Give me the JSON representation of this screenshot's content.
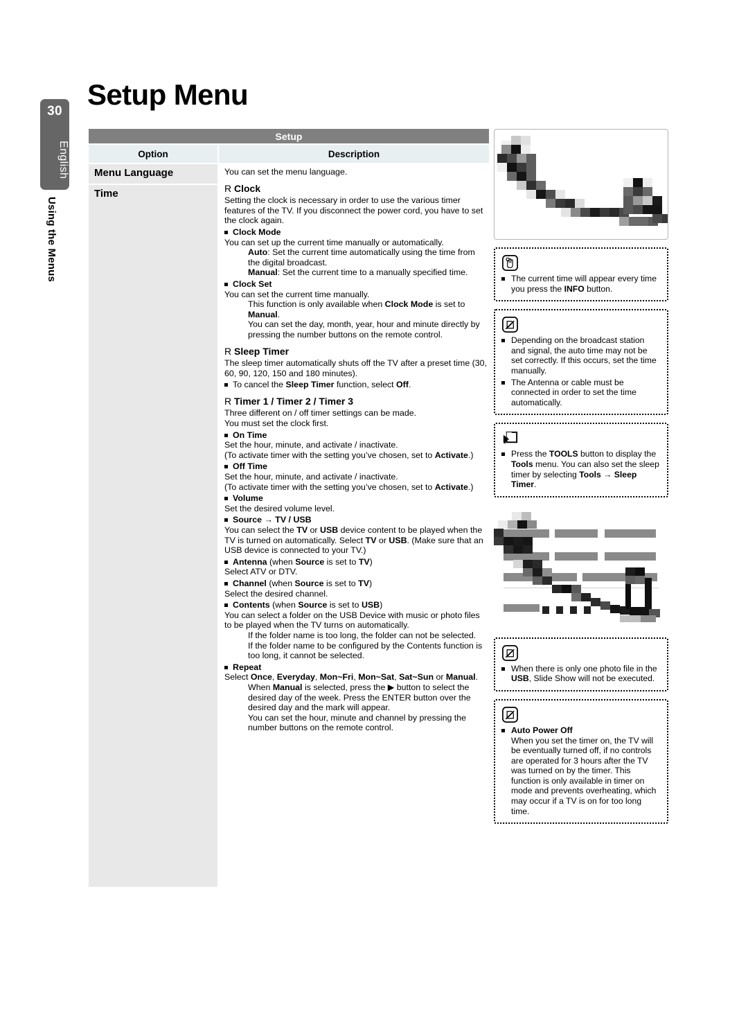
{
  "sidebar": {
    "page_number": "30",
    "language": "English",
    "chapter": "Using the Menus"
  },
  "page_title": "Setup Menu",
  "table": {
    "title": "Setup",
    "headers": {
      "option": "Option",
      "description": "Description"
    },
    "rows": [
      {
        "option": "Menu Language",
        "description": "You can set the menu language."
      },
      {
        "option": "Time",
        "description": ""
      }
    ]
  },
  "content": {
    "clock": {
      "heading": "Clock",
      "rmark": "R",
      "intro": "Setting the clock is necessary in order to use the various timer features of the TV. If you disconnect the power cord, you have to set the clock again.",
      "clock_mode_label": "Clock Mode",
      "clock_mode_text": "You can set up the current time manually or automatically.",
      "auto_label": "Auto",
      "auto_text": ": Set the current time automatically using the time from the digital broadcast.",
      "manual_label": "Manual",
      "manual_text": ": Set the current time to a manually specified time.",
      "clock_set_label": "Clock Set",
      "clock_set_text": "You can set the current time manually.",
      "clock_set_note1_a": "This function is only available when ",
      "clock_set_note1_b": "Clock Mode",
      "clock_set_note1_c": " is set to ",
      "clock_set_note1_d": "Manual",
      "clock_set_note1_e": ".",
      "clock_set_note2": "You can set the day, month, year, hour and minute directly by pressing the number buttons on the remote control."
    },
    "sleep_timer": {
      "heading": "Sleep Timer",
      "rmark": "R",
      "text": "The sleep timer automatically shuts off the TV after a preset time (30, 60, 90, 120, 150 and 180 minutes).",
      "cancel_a": "To cancel the ",
      "cancel_b": "Sleep Timer",
      "cancel_c": " function, select ",
      "cancel_d": "Off",
      "cancel_e": "."
    },
    "timers": {
      "heading": "Timer 1 / Timer 2 / Timer 3",
      "rmark": "R",
      "intro1": "Three different on / off timer settings can be made.",
      "intro2": "You must set the clock first.",
      "on_time_label": "On Time",
      "on_time_text": "Set the hour, minute, and activate / inactivate.",
      "on_time_note_a": "(To activate timer with the setting you’ve chosen, set to ",
      "on_time_note_b": "Activate",
      "on_time_note_c": ".)",
      "off_time_label": "Off Time",
      "off_time_text": "Set the hour, minute, and activate / inactivate.",
      "off_time_note_a": "(To activate timer with the setting you’ve chosen, set to ",
      "off_time_note_b": "Activate",
      "off_time_note_c": ".)",
      "volume_label": "Volume",
      "volume_text": "Set the desired volume level.",
      "source_label": "Source → TV / USB",
      "source_text_a": "You can select the ",
      "source_text_b": "TV",
      "source_text_c": " or ",
      "source_text_d": "USB",
      "source_text_e": " device content to be played when the TV is turned on automatically. Select ",
      "source_text_f": "TV",
      "source_text_g": " or ",
      "source_text_h": "USB",
      "source_text_i": ". (Make sure that an USB device is connected to your TV.)",
      "antenna_label": "Antenna",
      "antenna_cond_a": " (when ",
      "antenna_cond_b": "Source",
      "antenna_cond_c": " is set to ",
      "antenna_cond_d": "TV",
      "antenna_cond_e": ")",
      "antenna_text": "Select ATV or DTV.",
      "channel_label": "Channel",
      "channel_cond_a": " (when ",
      "channel_cond_b": "Source",
      "channel_cond_c": " is set to ",
      "channel_cond_d": "TV",
      "channel_cond_e": ")",
      "channel_text": "Select the desired channel.",
      "contents_label": "Contents",
      "contents_cond_a": " (when ",
      "contents_cond_b": "Source",
      "contents_cond_c": " is set to ",
      "contents_cond_d": "USB",
      "contents_cond_e": ")",
      "contents_text": "You can select a folder on the USB Device with music or photo files to be played when the TV turns on automatically.",
      "contents_note1": "If the folder name is too long, the folder can not be selected.",
      "contents_note2": "If the folder name to be configured by the Contents function is too long, it cannot be selected.",
      "repeat_label": "Repeat",
      "repeat_select_a": "Select ",
      "repeat_select_b": "Once",
      "repeat_select_c": ", ",
      "repeat_select_d": "Everyday",
      "repeat_select_e": ", ",
      "repeat_select_f": "Mon~Fri",
      "repeat_select_g": ", ",
      "repeat_select_h": "Mon~Sat",
      "repeat_select_i": ", ",
      "repeat_select_j": "Sat~Sun",
      "repeat_select_k": " or ",
      "repeat_select_l": "Manual",
      "repeat_select_m": ".",
      "repeat_note1_a": "When ",
      "repeat_note1_b": "Manual",
      "repeat_note1_c": " is selected, press the ▶ button to select the desired day of the week. Press the ENTER     button over the desired day and the      mark will appear.",
      "repeat_note2": "You can set the hour, minute and channel by pressing the number buttons on the remote control."
    }
  },
  "notes": [
    {
      "icon": "hand-press-icon",
      "items": [
        {
          "a": "The current time will appear every time you press the ",
          "b": "INFO",
          "c": " button."
        }
      ]
    },
    {
      "icon": "note-pencil-icon",
      "items": [
        {
          "a": "Depending on the broadcast station and signal, the auto time may not be set correctly. If this occurs, set the time manually.",
          "b": "",
          "c": ""
        },
        {
          "a": "The Antenna or cable must be connected in order to set the time automatically.",
          "b": "",
          "c": ""
        }
      ]
    },
    {
      "icon": "tools-cursor-icon",
      "items": [
        {
          "a": "Press the ",
          "b": "TOOLS",
          "c": " button to display the ",
          "d": "Tools",
          "e": " menu. You can also set the sleep timer by selecting ",
          "f": "Tools → Sleep Timer",
          "g": "."
        }
      ]
    },
    {
      "icon": "note-pencil-icon",
      "items": [
        {
          "a": "When there is only one photo file in the ",
          "b": "USB",
          "c": ", Slide Show will not be executed."
        }
      ]
    },
    {
      "icon": "note-pencil-icon",
      "heading": "Auto Power Off",
      "items": [
        {
          "a": "When you set the timer on, the TV will be eventually turned off, if no controls are operated for 3 hours after the TV was turned on by the timer. This function is only available in timer on mode and prevents overheating, which may occur if a TV is on for too long time.",
          "b": "",
          "c": ""
        }
      ]
    }
  ],
  "colors": {
    "table_title_bg": "#808080",
    "table_head_bg": "#e7eff0",
    "option_cell_bg": "#e8e8e8",
    "sidebar_bg": "#666666"
  }
}
